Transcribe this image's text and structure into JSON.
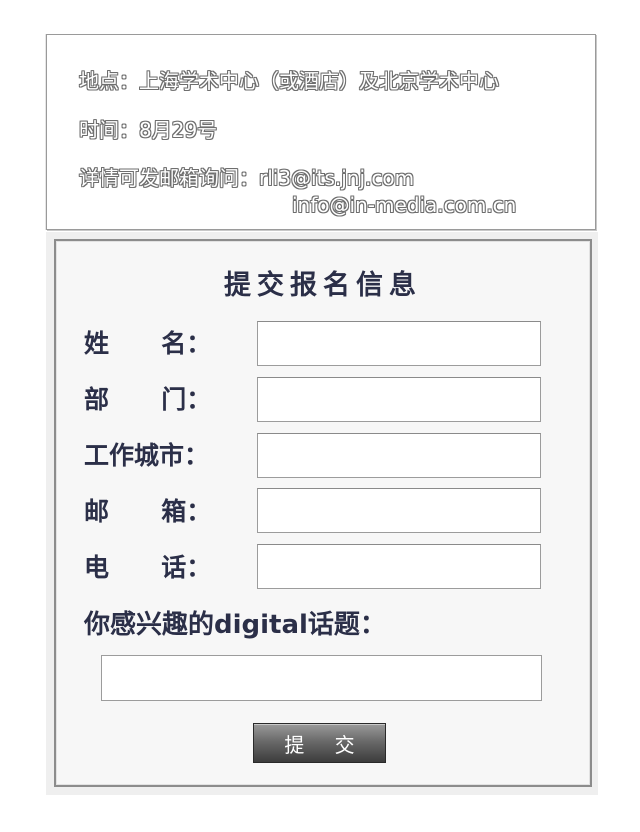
{
  "info": {
    "location": "地点：上海学术中心（或酒店）及北京学术中心",
    "time": "时间：8月29号",
    "contact": "详情可发邮箱询问：rli3@its.jnj.com",
    "email2": "info@in-media.com.cn"
  },
  "form": {
    "title": "提交报名信息",
    "fields": [
      {
        "label": "姓      名：",
        "value": ""
      },
      {
        "label": "部      门：",
        "value": ""
      },
      {
        "label": "工作城市：",
        "value": ""
      },
      {
        "label": "邮      箱：",
        "value": ""
      },
      {
        "label": "电      话：",
        "value": ""
      }
    ],
    "topic_label": "你感兴趣的digital话题：",
    "topic_value": "",
    "submit_label": "提 交"
  }
}
